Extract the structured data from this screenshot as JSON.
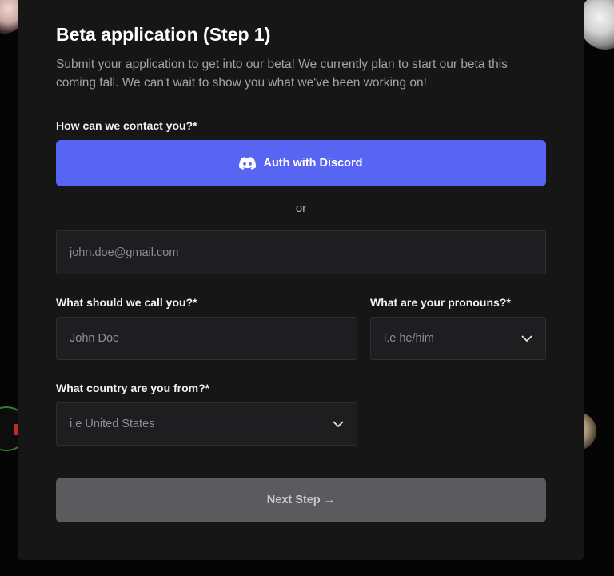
{
  "form": {
    "title": "Beta application (Step 1)",
    "subtitle": "Submit your application to get into our beta! We currently plan to start our beta this coming fall. We can't wait to show you what we've been working on!"
  },
  "contact": {
    "label": "How can we contact you?*",
    "discord_button": "Auth with Discord",
    "divider": "or",
    "email_placeholder": "john.doe@gmail.com"
  },
  "name": {
    "label": "What should we call you?*",
    "placeholder": "John Doe"
  },
  "pronouns": {
    "label": "What are your pronouns?*",
    "placeholder": "i.e he/him"
  },
  "country": {
    "label": "What country are you from?*",
    "placeholder": "i.e United States"
  },
  "actions": {
    "next_label": "Next Step →"
  },
  "colors": {
    "discord": "#5865f2",
    "panel": "#161617",
    "field_bg": "#1e1e20",
    "disabled_button": "#5b5b5e"
  },
  "icons": {
    "discord": "discord-icon",
    "select_arrow": "chevron-down-icon"
  }
}
